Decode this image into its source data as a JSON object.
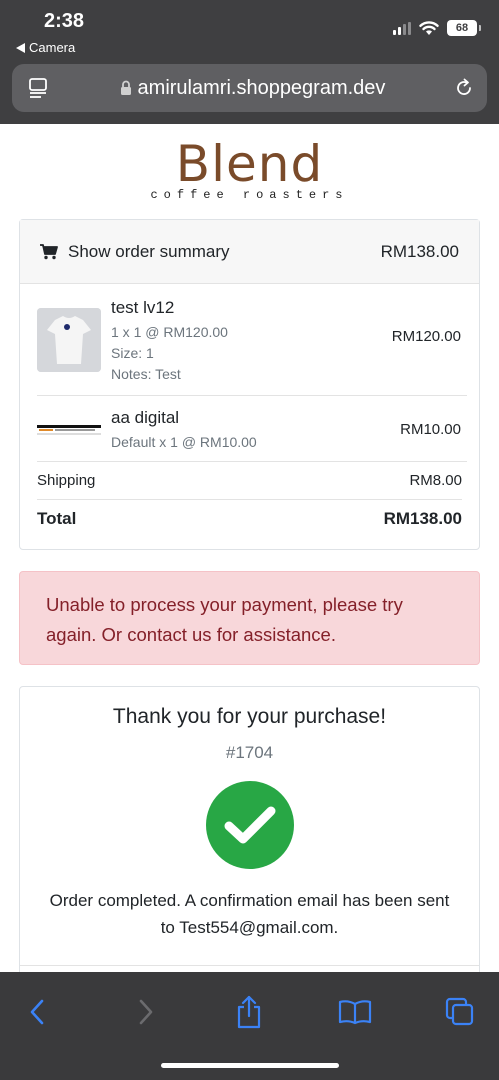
{
  "status_bar": {
    "time": "2:38",
    "back_app": "Camera",
    "battery": "68"
  },
  "browser": {
    "url": "amirulamri.shoppegram.dev"
  },
  "brand": {
    "name": "Blend",
    "tagline": "coffee roasters",
    "color": "#7a4b2a"
  },
  "order_summary": {
    "toggle_label": "Show order summary",
    "header_total": "RM138.00",
    "items": [
      {
        "name": "test lv12",
        "quantity_line": "1 x 1 @ RM120.00",
        "size_line": "Size: 1",
        "notes_line": "Notes: Test",
        "price": "RM120.00"
      },
      {
        "name": "aa digital",
        "quantity_line": "Default x 1 @ RM10.00",
        "price": "RM10.00"
      }
    ],
    "shipping_label": "Shipping",
    "shipping_value": "RM8.00",
    "total_label": "Total",
    "total_value": "RM138.00"
  },
  "alert": {
    "message": "Unable to process your payment, please try again. Or contact us for assistance."
  },
  "confirmation": {
    "title": "Thank you for your purchase!",
    "order_number": "#1704",
    "message": "Order completed. A confirmation email has been sent to Test554@gmail.com."
  },
  "colors": {
    "success": "#28a745",
    "alert_bg": "#f8d7da",
    "alert_text": "#842029",
    "ios_accent": "#3b82f6"
  },
  "icons": [
    "back-arrow-icon",
    "wifi-icon",
    "signal-icon",
    "battery-icon",
    "reader-mode-icon",
    "lock-icon",
    "reload-icon",
    "cart-icon",
    "checkmark-icon",
    "chevron-left-icon",
    "chevron-right-icon",
    "share-icon",
    "bookmarks-icon",
    "tabs-icon"
  ]
}
